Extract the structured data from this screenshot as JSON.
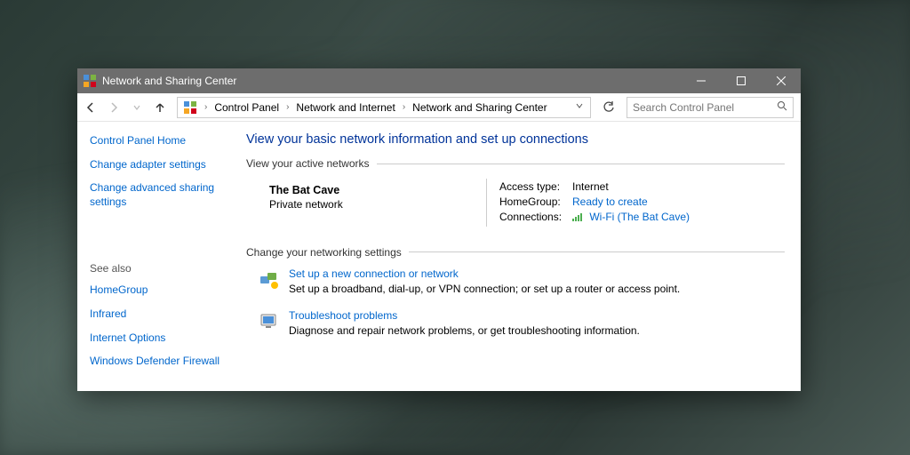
{
  "window": {
    "title": "Network and Sharing Center"
  },
  "breadcrumb": {
    "items": [
      "Control Panel",
      "Network and Internet",
      "Network and Sharing Center"
    ]
  },
  "search": {
    "placeholder": "Search Control Panel"
  },
  "sidebar": {
    "links": [
      "Control Panel Home",
      "Change adapter settings",
      "Change advanced sharing settings"
    ],
    "see_also_label": "See also",
    "see_also": [
      "HomeGroup",
      "Infrared",
      "Internet Options",
      "Windows Defender Firewall"
    ]
  },
  "main": {
    "heading": "View your basic network information and set up connections",
    "active_label": "View your active networks",
    "network": {
      "name": "The Bat Cave",
      "type": "Private network",
      "access_label": "Access type:",
      "access_value": "Internet",
      "homegroup_label": "HomeGroup:",
      "homegroup_value": "Ready to create",
      "connections_label": "Connections:",
      "connections_value": "Wi-Fi (The Bat Cave)"
    },
    "change_label": "Change your networking settings",
    "settings": [
      {
        "title": "Set up a new connection or network",
        "desc": "Set up a broadband, dial-up, or VPN connection; or set up a router or access point."
      },
      {
        "title": "Troubleshoot problems",
        "desc": "Diagnose and repair network problems, or get troubleshooting information."
      }
    ]
  }
}
